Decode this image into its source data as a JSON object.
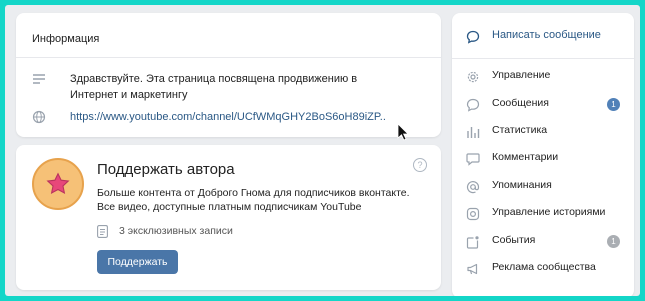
{
  "info": {
    "title": "Информация",
    "description": "Здравствуйте. Эта страница посвящена продвижению в Интернет и маркетингу",
    "link": "https://www.youtube.com/channel/UCfWMqGHY2BoS6oH89iZP.."
  },
  "support": {
    "title": "Поддержать автора",
    "description": "Больше контента от Доброго Гнома для подписчиков вконтакте. Все видео, доступные платным подписчикам YouTube",
    "exclusive": "3 эксклюзивных записи",
    "button": "Поддержать",
    "help": "?"
  },
  "menu": {
    "write": "Написать сообщение",
    "items": [
      {
        "label": "Управление",
        "icon": "gear-icon"
      },
      {
        "label": "Сообщения",
        "icon": "chat-icon",
        "badge": "1"
      },
      {
        "label": "Статистика",
        "icon": "stats-icon"
      },
      {
        "label": "Комментарии",
        "icon": "comment-icon"
      },
      {
        "label": "Упоминания",
        "icon": "at-icon"
      },
      {
        "label": "Управление историями",
        "icon": "stories-icon"
      },
      {
        "label": "События",
        "icon": "events-icon",
        "badge": "1"
      },
      {
        "label": "Реклама сообщества",
        "icon": "megaphone-icon"
      }
    ]
  },
  "colors": {
    "accent": "#4a76a8",
    "link": "#2a5885",
    "frame": "#14d6c8",
    "badge_blue": "#5181b8",
    "badge_grey": "#aaaeb3"
  }
}
